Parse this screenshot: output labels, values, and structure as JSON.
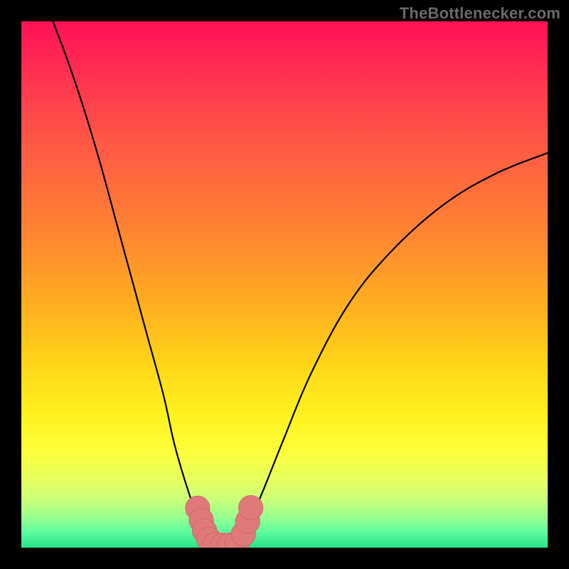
{
  "watermark": {
    "text": "TheBottlenecker.com"
  },
  "colors": {
    "frame": "#000000",
    "curve_stroke": "#000000",
    "marker_fill": "#e07a78",
    "marker_stroke": "#c96b69",
    "gradient_top": "#ff1155",
    "gradient_bottom": "#27e28a"
  },
  "chart_data": {
    "type": "line",
    "title": "",
    "xlabel": "",
    "ylabel": "",
    "xlim": [
      0,
      100
    ],
    "ylim": [
      0,
      100
    ],
    "grid": false,
    "legend": false,
    "series": [
      {
        "name": "left-curve",
        "description": "Steep descending curve from top-left toward minimum",
        "x": [
          6,
          9,
          12,
          15,
          18,
          21,
          24,
          27,
          29,
          31,
          33,
          34.5,
          36
        ],
        "y": [
          100,
          92,
          83,
          73,
          62,
          51,
          40,
          29,
          20,
          13,
          7,
          3,
          0.5
        ]
      },
      {
        "name": "right-curve",
        "description": "Curve rising from minimum toward upper-right",
        "x": [
          41,
          43,
          46,
          50,
          55,
          62,
          70,
          80,
          90,
          100
        ],
        "y": [
          0.5,
          4,
          11,
          21,
          33,
          46,
          56,
          65,
          71,
          75
        ]
      }
    ],
    "flat_segment": {
      "x_start": 36,
      "x_end": 41,
      "y": 0.5
    },
    "markers": {
      "description": "Pink rounded marker cluster near the valley bottom",
      "points": [
        {
          "x": 33.5,
          "y": 7.5,
          "r": 2.2
        },
        {
          "x": 34.2,
          "y": 5.2,
          "r": 2.2
        },
        {
          "x": 34.8,
          "y": 3.2,
          "r": 2.2
        },
        {
          "x": 35.6,
          "y": 1.6,
          "r": 2.2
        },
        {
          "x": 36.8,
          "y": 0.6,
          "r": 2.2
        },
        {
          "x": 38.2,
          "y": 0.5,
          "r": 2.2
        },
        {
          "x": 39.6,
          "y": 0.5,
          "r": 2.2
        },
        {
          "x": 41.0,
          "y": 0.8,
          "r": 2.2
        },
        {
          "x": 42.2,
          "y": 2.6,
          "r": 2.2
        },
        {
          "x": 43.0,
          "y": 5.0,
          "r": 2.2
        },
        {
          "x": 43.6,
          "y": 7.6,
          "r": 2.2
        }
      ]
    }
  }
}
